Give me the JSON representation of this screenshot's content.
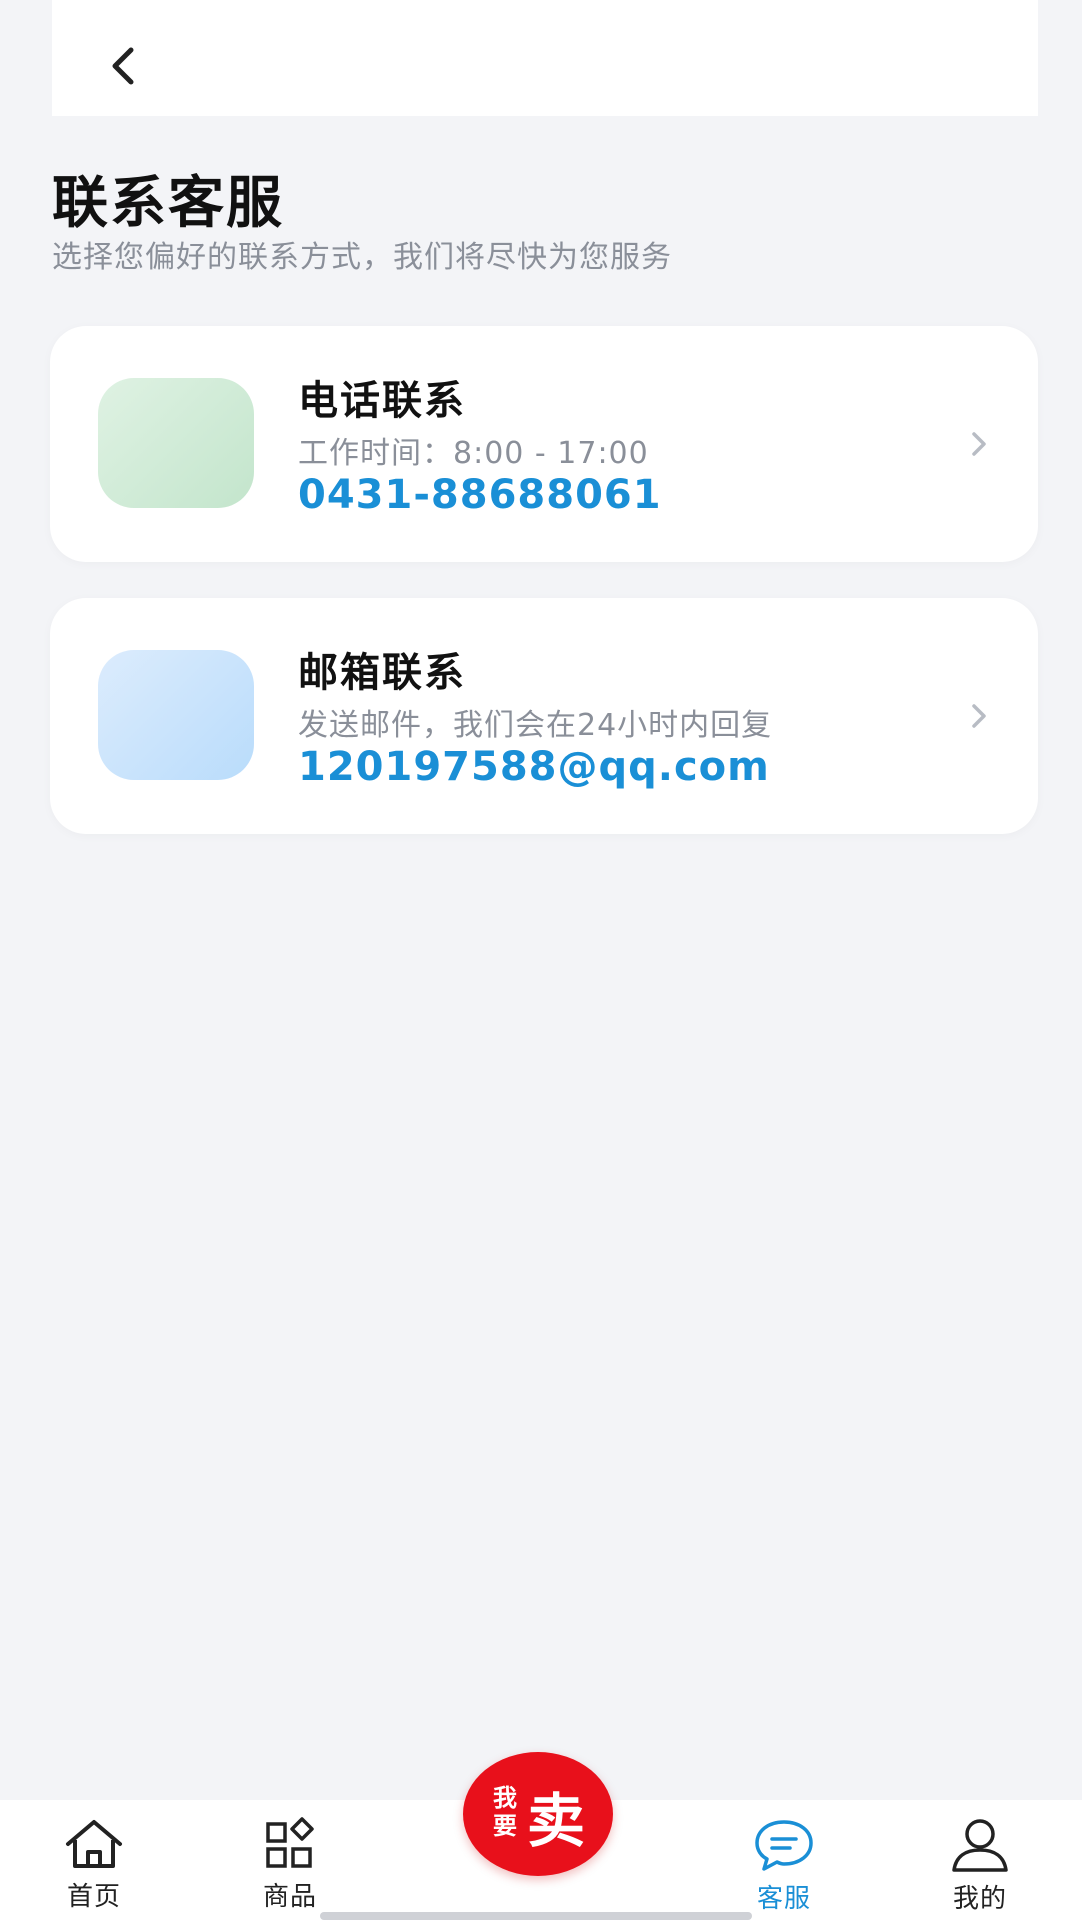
{
  "header": {
    "title": "联系客服",
    "subtitle": "选择您偏好的联系方式，我们将尽快为您服务"
  },
  "contacts": [
    {
      "title": "电话联系",
      "desc": "工作时间：8:00 - 17:00",
      "value": "0431-88688061",
      "icon_color": "#d3ecd9"
    },
    {
      "title": "邮箱联系",
      "desc": "发送邮件，我们会在24小时内回复",
      "value": "120197588@qq.com",
      "icon_color": "#cfe6fb"
    }
  ],
  "tabbar": {
    "home": "首页",
    "products": "商品",
    "sell_small": "我要",
    "sell_big": "卖",
    "service": "客服",
    "mine": "我的",
    "active": "service",
    "active_color": "#1a8fd6",
    "sell_color": "#e8101b"
  }
}
